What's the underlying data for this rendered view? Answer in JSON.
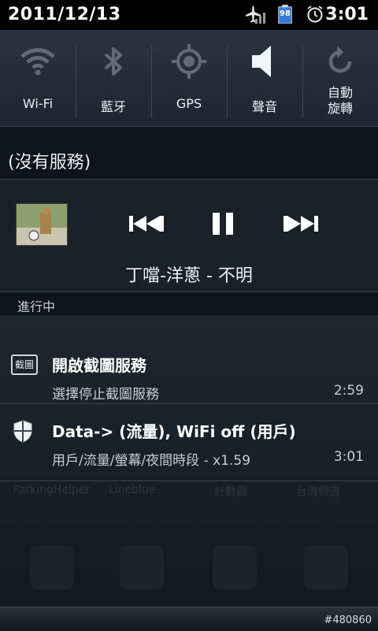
{
  "status_bar": {
    "date": "2011/12/13",
    "battery": "98",
    "time": "3:01",
    "icons": [
      "airplane-mode-icon",
      "signal-icon",
      "battery-icon",
      "alarm-icon"
    ]
  },
  "toggles": [
    {
      "label": "Wi-Fi",
      "icon": "wifi-icon"
    },
    {
      "label": "藍牙",
      "icon": "bluetooth-icon"
    },
    {
      "label": "GPS",
      "icon": "gps-icon"
    },
    {
      "label": "聲音",
      "icon": "sound-icon"
    },
    {
      "label": "自動\n旋轉",
      "icon": "auto-rotate-icon"
    }
  ],
  "carrier": "(沒有服務)",
  "music": {
    "title": "丁噹-洋蔥 - 不明",
    "controls": [
      "previous-icon",
      "pause-icon",
      "next-icon"
    ]
  },
  "ongoing_label": "進行中",
  "notifications": [
    {
      "icon_label": "截圖",
      "title": "開啟截圖服務",
      "subtitle": "選擇停止截圖服務",
      "time": "2:59"
    },
    {
      "title": "Data-> (流量), WiFi off (用戶)",
      "subtitle": "用戶/流量/螢幕/夜間時段 - x1.59",
      "time": "3:01"
    }
  ],
  "background_apps": [
    "ParkingHelper",
    "Lineblue",
    "計數器",
    "台灣頻道"
  ],
  "watermark": "#480860",
  "colors": {
    "accent": "#ffffff",
    "panel": "#1c2630",
    "background": "#0f141b"
  }
}
